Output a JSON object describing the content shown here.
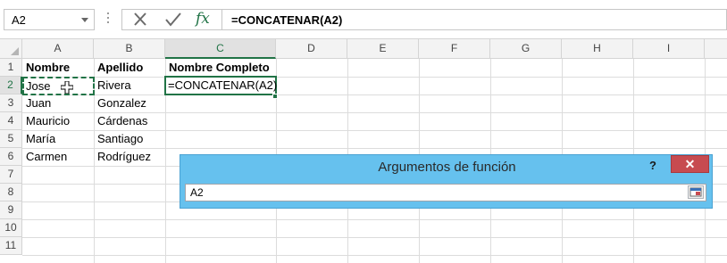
{
  "formula_bar": {
    "name_box": "A2",
    "fx_label": "fx",
    "formula": "=CONCATENAR(A2)"
  },
  "columns": [
    "A",
    "B",
    "C",
    "D",
    "E",
    "F",
    "G",
    "H",
    "I"
  ],
  "rows": [
    "1",
    "2",
    "3",
    "4",
    "5",
    "6",
    "7",
    "8",
    "9",
    "10",
    "11"
  ],
  "cells": {
    "A1": "Nombre",
    "B1": "Apellido",
    "C1": "Nombre Completo",
    "A2": "Jose",
    "B2": "Rivera",
    "C2": "=CONCATENAR(A2)",
    "A3": "Juan",
    "B3": "Gonzalez",
    "A4": "Mauricio",
    "B4": "Cárdenas",
    "A5": "María",
    "B5": "Santiago",
    "A6": "Carmen",
    "B6": "Rodríguez"
  },
  "dialog": {
    "title": "Argumentos de función",
    "help": "?",
    "close": "✕",
    "argument_value": "A2"
  },
  "colors": {
    "accent": "#217346",
    "dialog_bg": "#66c1ee",
    "close_bg": "#c74b50"
  },
  "icons": [
    "cancel-icon",
    "enter-icon",
    "insert-function-icon",
    "range-collapse-icon",
    "cell-cursor-icon"
  ]
}
